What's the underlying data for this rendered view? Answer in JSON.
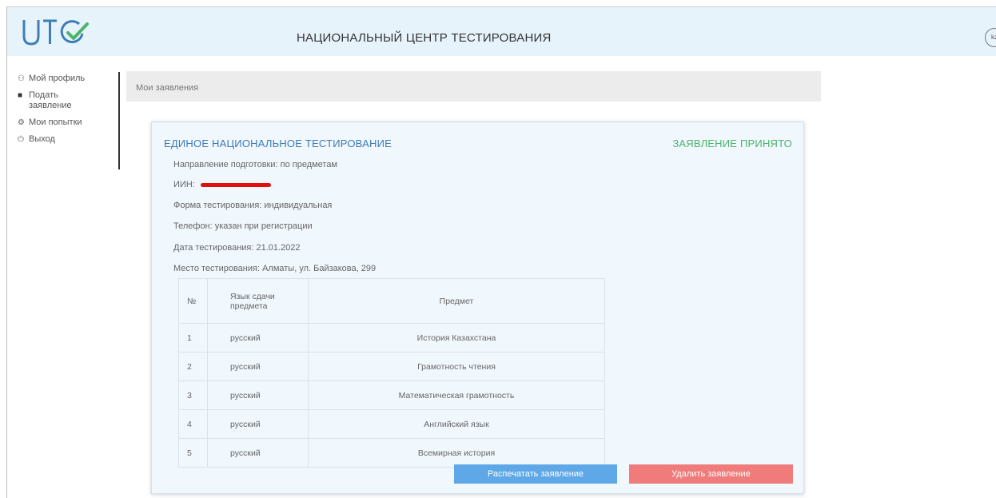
{
  "header": {
    "title": "НАЦИОНАЛЬНЫЙ ЦЕНТР ТЕСТИРОВАНИЯ",
    "user_button": "kz"
  },
  "colors": {
    "header_bg": "#e7f3fb",
    "card_title": "#3c7ab8",
    "status_ok": "#4db36b",
    "button_primary": "#5fa8e8",
    "button_danger": "#ef7b7b",
    "redaction": "#e01010"
  },
  "sidebar": {
    "items": [
      {
        "icon": "user-icon",
        "label": "Мой профиль"
      },
      {
        "icon": "document-icon",
        "label": "Подать заявление"
      },
      {
        "icon": "settings-icon",
        "label": "Мои попытки"
      },
      {
        "icon": "logout-icon",
        "label": "Выход"
      }
    ]
  },
  "breadcrumb": "Мои заявления",
  "card": {
    "title": "ЕДИНОЕ НАЦИОНАЛЬНОЕ ТЕСТИРОВАНИЕ",
    "status": "ЗАЯВЛЕНИЕ ПРИНЯТО",
    "fields": {
      "profile": "Направление подготовки: по предметам",
      "iin_label": "ИИН:",
      "form": "Форма тестирования: индивидуальная",
      "phone": "Телефон: указан при регистрации",
      "date": "Дата тестирования: 21.01.2022",
      "place": "Место тестирования: Алматы, ул. Байзакова, 299"
    },
    "table": {
      "headers": [
        "№",
        "Язык сдачи предмета",
        "Предмет"
      ],
      "rows": [
        [
          "1",
          "русский",
          "История Казахстана"
        ],
        [
          "2",
          "русский",
          "Грамотность чтения"
        ],
        [
          "3",
          "русский",
          "Математическая грамотность"
        ],
        [
          "4",
          "русский",
          "Английский язык"
        ],
        [
          "5",
          "русский",
          "Всемирная история"
        ]
      ]
    },
    "buttons": {
      "print": "Распечатать заявление",
      "delete": "Удалить заявление"
    }
  }
}
